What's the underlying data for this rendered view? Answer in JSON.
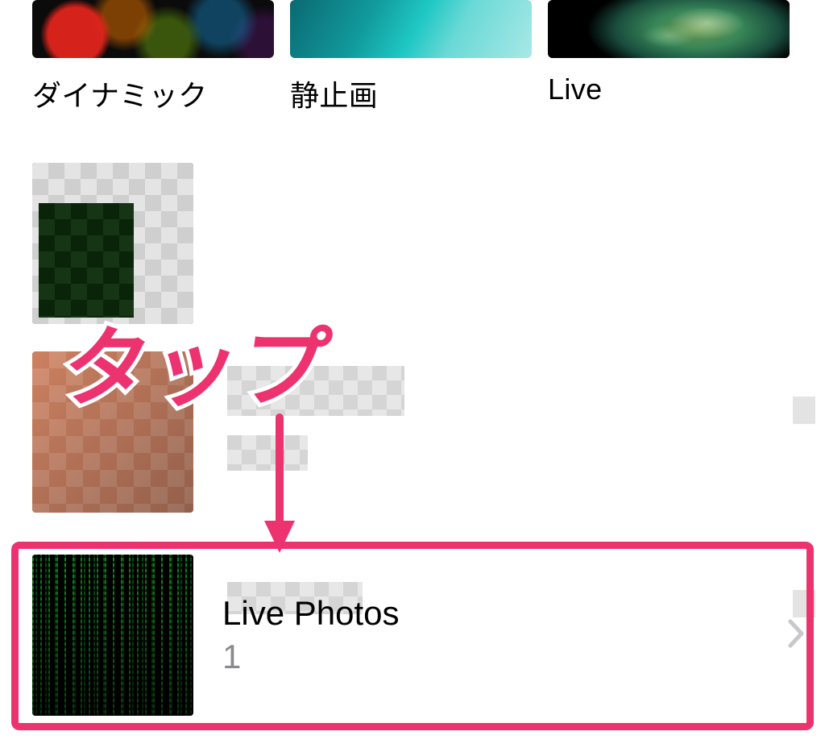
{
  "categories": [
    {
      "label": "ダイナミック"
    },
    {
      "label": "静止画"
    },
    {
      "label": "Live"
    }
  ],
  "albums": {
    "live_photos": {
      "title": "Live Photos",
      "count": "1"
    }
  },
  "annotation": {
    "tap_label": "タップ"
  },
  "colors": {
    "accent": "#ec336f"
  }
}
